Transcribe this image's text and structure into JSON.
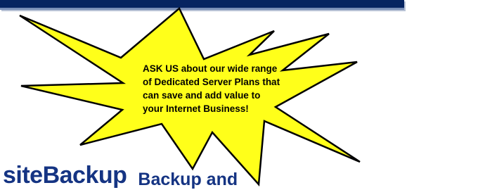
{
  "promo": {
    "text": "ASK US about our wide range of Dedicated Server Plans that can save and add value to your Internet Business!"
  },
  "section": {
    "title": "siteBackup",
    "subtitle": "Backup and"
  },
  "colors": {
    "top_bar": "#062461",
    "starburst_fill": "#ffff1a",
    "heading": "#153483"
  }
}
